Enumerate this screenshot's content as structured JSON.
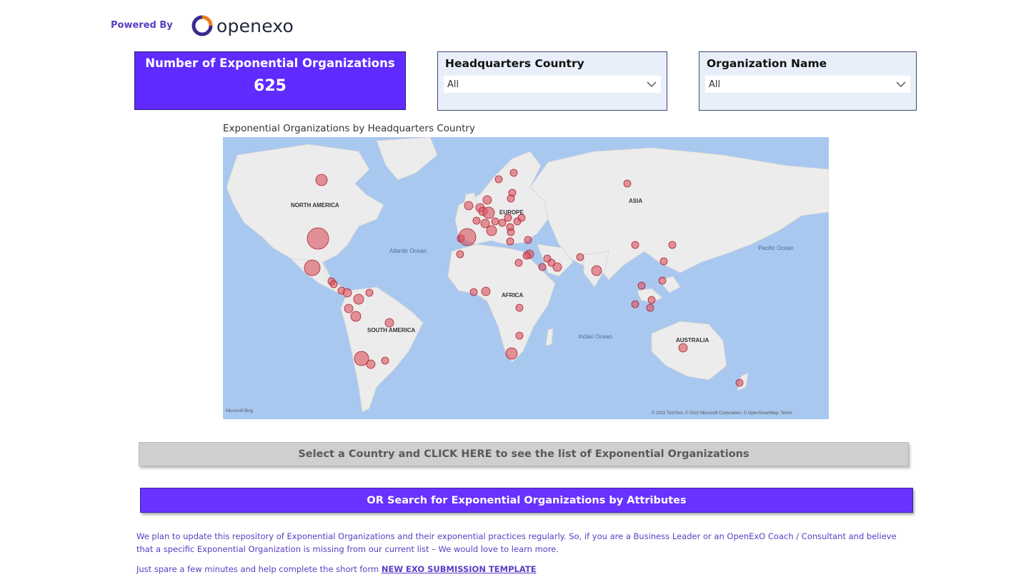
{
  "header": {
    "powered_by": "Powered By",
    "logo_text": "openexo",
    "logo_colors": [
      "#f07a1a",
      "#3b2b8c"
    ]
  },
  "kpi": {
    "title": "Number of Exponential Organizations",
    "value": "625",
    "background": "#5f2bff"
  },
  "filters": {
    "country": {
      "title": "Headquarters Country",
      "value": "All"
    },
    "organization": {
      "title": "Organization Name",
      "value": "All"
    }
  },
  "map": {
    "title": "Exponential Organizations by Headquarters Country",
    "labels": {
      "north_america": "NORTH AMERICA",
      "europe": "EUROPE",
      "asia": "ASIA",
      "africa": "AFRICA",
      "south_america": "SOUTH AMERICA",
      "australia": "AUSTRALIA",
      "atlantic": "Atlantic Ocean",
      "pacific": "Pacific Ocean",
      "indian": "Indian Ocean"
    },
    "attribution": "© 2022 TomTom, © 2022 Microsoft Corporation, © OpenStreetMap, Terms",
    "brand": "Microsoft Bing",
    "bubble_color": "#d9525e"
  },
  "buttons": {
    "country_list": "Select a Country and CLICK HERE to see the list of Exponential Organizations",
    "search": "OR Search for Exponential Organizations by Attributes"
  },
  "footer": {
    "paragraph": "We plan to update this repository of Exponential Organizations and their exponential practices regularly. So, if you are a Business Leader or an OpenExO Coach / Consultant and believe that a specific Exponential Organization is missing from our current list – We would love to learn more.",
    "cta_prefix": "Just spare a few minutes and help complete the short form",
    "cta_link": "NEW EXO SUBMISSION TEMPLATE"
  }
}
